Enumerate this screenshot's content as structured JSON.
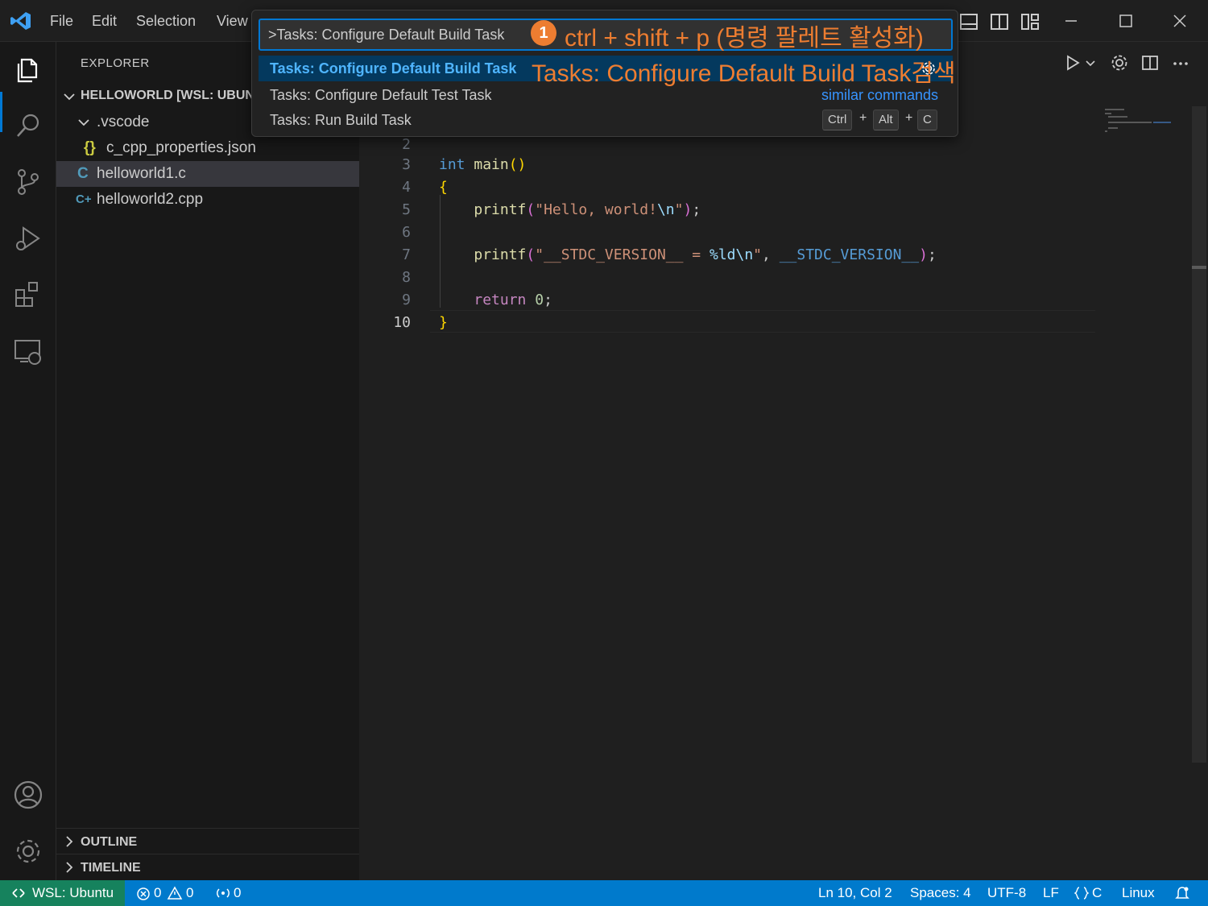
{
  "menu": {
    "file": "File",
    "edit": "Edit",
    "selection": "Selection",
    "view": "View"
  },
  "sidebar": {
    "title": "EXPLORER",
    "root": "HELLOWORLD [WSL: UBUNTU]",
    "folder": ".vscode",
    "files": [
      {
        "icon": "{}",
        "name": "c_cpp_properties.json"
      },
      {
        "icon": "C",
        "name": "helloworld1.c"
      },
      {
        "icon": "C+",
        "name": "helloworld2.cpp"
      }
    ],
    "outline": "OUTLINE",
    "timeline": "TIMELINE"
  },
  "editor": {
    "line_numbers": [
      "2",
      "3",
      "4",
      "5",
      "6",
      "7",
      "8",
      "9",
      "10"
    ]
  },
  "palette": {
    "input": ">Tasks: Configure Default Build Task",
    "items": [
      "Tasks: Configure Default Build Task",
      "Tasks: Configure Default Test Task",
      "Tasks: Run Build Task"
    ],
    "similar": "similar commands",
    "keys": [
      "Ctrl",
      "Alt",
      "C"
    ],
    "plus": "+"
  },
  "annotations": {
    "badge": "1",
    "step1": "ctrl + shift + p (명령 팔레트 활성화)",
    "step2": "Tasks: Configure Default Build Task검색"
  },
  "status": {
    "remote": "WSL: Ubuntu",
    "errors": "0",
    "warnings": "0",
    "ports": "0",
    "position": "Ln 10, Col 2",
    "spaces": "Spaces: 4",
    "encoding": "UTF-8",
    "eol": "LF",
    "language": "C",
    "platform": "Linux"
  },
  "colors": {
    "accent": "#0078d4",
    "statusbar": "#007acc",
    "remote": "#16825d",
    "annotation": "#ed7d31"
  }
}
